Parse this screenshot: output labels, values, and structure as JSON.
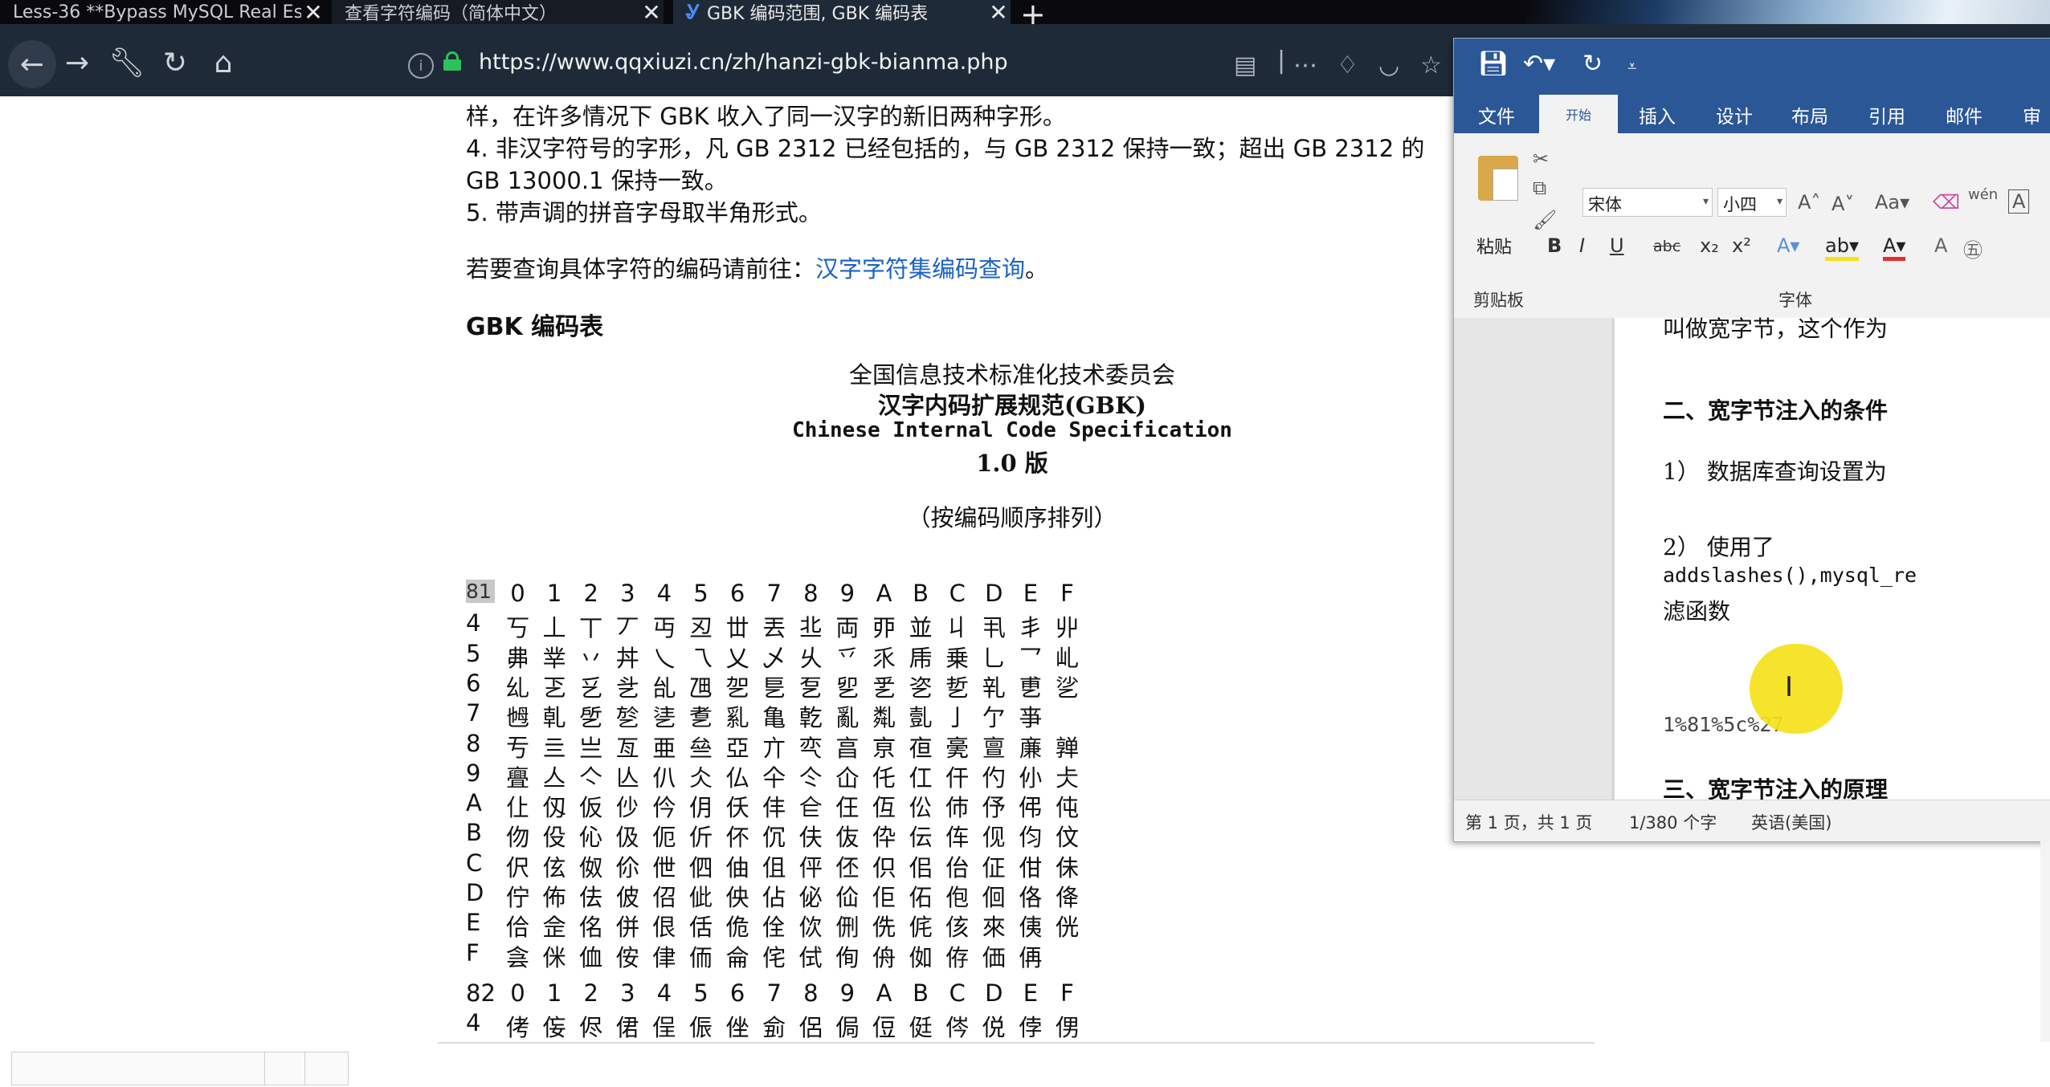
{
  "browser": {
    "tabs": [
      {
        "title": "Less-36 **Bypass MySQL Real Es",
        "close": "✕"
      },
      {
        "title": "查看字符编码（简体中文）",
        "close": "✕"
      },
      {
        "title": "GBK 编码范围, GBK 编码表",
        "close": "✕"
      }
    ],
    "new_tab": "+",
    "url": "https://www.qqxiuzi.cn/zh/hanzi-gbk-bianma.php"
  },
  "page": {
    "lines": [
      "样，在许多情况下 GBK 收入了同一汉字的新旧两种字形。",
      "4. 非汉字符号的字形，凡 GB 2312 已经包括的，与 GB 2312 保持一致；超出 GB 2312 的",
      "GB 13000.1 保持一致。",
      "5. 带声调的拼音字母取半角形式。"
    ],
    "query_prefix": "若要查询具体字符的编码请前往：",
    "query_link": "汉字字符集编码查询",
    "query_suffix": "。",
    "gbk_heading": "GBK 编码表",
    "spec_org": "全国信息技术标准化技术委员会",
    "spec_title_cn": "汉字内码扩展规范(GBK)",
    "spec_title_en": "Chinese Internal Code Specification",
    "spec_version": "1.0 版",
    "spec_order": "（按编码顺序排列）",
    "grid81": {
      "lead": "81",
      "headers": [
        "0",
        "1",
        "2",
        "3",
        "4",
        "5",
        "6",
        "7",
        "8",
        "9",
        "A",
        "B",
        "C",
        "D",
        "E",
        "F"
      ],
      "rows": [
        {
          "label": "4",
          "chars": [
            "丂",
            "丄",
            "丅",
            "丆",
            "丏",
            "丒",
            "丗",
            "丟",
            "丠",
            "両",
            "丣",
            "並",
            "丩",
            "丮",
            "丯",
            "丱"
          ]
        },
        {
          "label": "5",
          "chars": [
            "丳",
            "丵",
            "丷",
            "丼",
            "乀",
            "乁",
            "乂",
            "乄",
            "乆",
            "乊",
            "乑",
            "乕",
            "乗",
            "乚",
            "乛",
            "乢"
          ]
        },
        {
          "label": "6",
          "chars": [
            "乣",
            "乤",
            "乥",
            "乧",
            "乨",
            "乪",
            "乫",
            "乬",
            "乭",
            "乮",
            "乯",
            "乲",
            "乴",
            "乵",
            "乶",
            "乷"
          ]
        },
        {
          "label": "7",
          "chars": [
            "乸",
            "乹",
            "乺",
            "乻",
            "乼",
            "乽",
            "乿",
            "亀",
            "亁",
            "亂",
            "亃",
            "亄",
            "亅",
            "亇",
            "亊",
            ""
          ]
        },
        {
          "label": "8",
          "chars": [
            "亐",
            "亖",
            "亗",
            "亙",
            "亜",
            "亝",
            "亞",
            "亣",
            "亪",
            "亯",
            "亰",
            "亱",
            "亴",
            "亶",
            "亷",
            "亸"
          ]
        },
        {
          "label": "9",
          "chars": [
            "亹",
            "亼",
            "亽",
            "亾",
            "仈",
            "仌",
            "仏",
            "仐",
            "仒",
            "仚",
            "仛",
            "仜",
            "仠",
            "仢",
            "仦",
            "仧"
          ]
        },
        {
          "label": "A",
          "chars": [
            "仩",
            "仭",
            "仮",
            "仯",
            "仱",
            "仴",
            "仸",
            "仹",
            "仺",
            "仼",
            "仾",
            "伀",
            "伂",
            "伃",
            "伄",
            "伅"
          ]
        },
        {
          "label": "B",
          "chars": [
            "伆",
            "伇",
            "伈",
            "伋",
            "伌",
            "伒",
            "伓",
            "伔",
            "伕",
            "伖",
            "伜",
            "伝",
            "伡",
            "伣",
            "伨",
            "伩"
          ]
        },
        {
          "label": "C",
          "chars": [
            "伬",
            "伭",
            "伮",
            "伱",
            "伳",
            "伵",
            "伷",
            "伹",
            "伻",
            "伾",
            "伿",
            "佀",
            "佁",
            "佂",
            "佄",
            "佅"
          ]
        },
        {
          "label": "D",
          "chars": [
            "佇",
            "佈",
            "佉",
            "佊",
            "佋",
            "佌",
            "佒",
            "佔",
            "佖",
            "佡",
            "佢",
            "佦",
            "佨",
            "佪",
            "佫",
            "佭"
          ]
        },
        {
          "label": "E",
          "chars": [
            "佮",
            "佱",
            "佲",
            "併",
            "佷",
            "佸",
            "佹",
            "佺",
            "佽",
            "侀",
            "侁",
            "侂",
            "侅",
            "來",
            "侇",
            "侊"
          ]
        },
        {
          "label": "F",
          "chars": [
            "侌",
            "侎",
            "侐",
            "侒",
            "侓",
            "侕",
            "侖",
            "侘",
            "侙",
            "侚",
            "侜",
            "侞",
            "侟",
            "価",
            "侢",
            ""
          ]
        }
      ]
    },
    "grid82": {
      "lead": "82",
      "headers": [
        "0",
        "1",
        "2",
        "3",
        "4",
        "5",
        "6",
        "7",
        "8",
        "9",
        "A",
        "B",
        "C",
        "D",
        "E",
        "F"
      ],
      "rows": [
        {
          "label": "4",
          "chars": [
            "侤",
            "侫",
            "侭",
            "侰",
            "侱",
            "侲",
            "侳",
            "侴",
            "侶",
            "侷",
            "侸",
            "侹",
            "侺",
            "侻",
            "侼",
            "侽"
          ]
        }
      ]
    }
  },
  "word": {
    "quick_access": [
      "save-icon",
      "undo-icon",
      "redo-icon",
      "customize-icon"
    ],
    "tabs": [
      "文件",
      "开始",
      "插入",
      "设计",
      "布局",
      "引用",
      "邮件",
      "审阅"
    ],
    "active_tab": "开始",
    "paste_label": "粘贴",
    "clipboard_group": "剪贴板",
    "font_name": "宋体",
    "font_size": "小四",
    "font_group": "字体",
    "format_buttons": [
      "B",
      "I",
      "U",
      "abc",
      "x₂",
      "x²"
    ],
    "doc": {
      "line1": "叫做宽字节，这个作为",
      "h2": "二、宽字节注入的条件",
      "item1": "1）  数据库查询设置为",
      "item2_a": "2）  使用了",
      "item2_b": "addslashes(),mysql_re",
      "item2_c": "滤函数",
      "payload": "1%81%5c%27",
      "h3": "三、宽字节注入的原理"
    },
    "status": {
      "page": "第 1 页，共 1 页",
      "words": "1/380 个字",
      "lang": "英语(美国)"
    }
  }
}
